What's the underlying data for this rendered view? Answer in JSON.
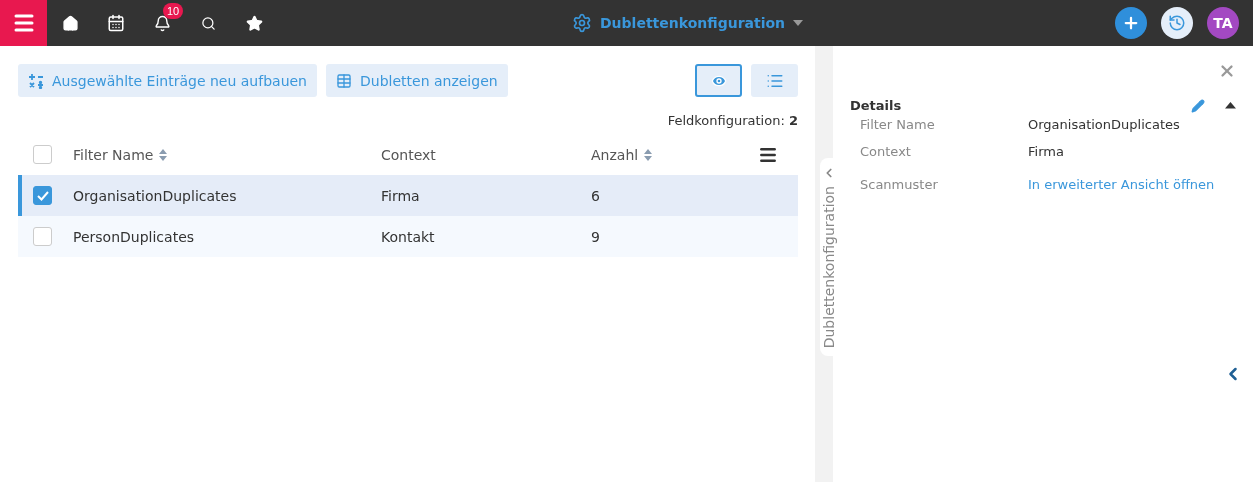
{
  "topbar": {
    "notification_count": "10",
    "title": "Dublettenkonfiguration",
    "avatar_initials": "TA"
  },
  "toolbar": {
    "buttons": [
      {
        "kind": "rebuild",
        "label": "Ausgewählte Einträge neu aufbauen"
      },
      {
        "kind": "table",
        "label": "Dubletten anzeigen"
      }
    ],
    "views": [
      {
        "kind": "eye",
        "selected": true
      },
      {
        "kind": "list",
        "selected": false
      }
    ]
  },
  "count": {
    "label": "Feldkonfiguration:",
    "value": "2"
  },
  "table": {
    "columns": [
      {
        "label": "Filter Name",
        "sortable": true
      },
      {
        "label": "Context",
        "sortable": false
      },
      {
        "label": "Anzahl",
        "sortable": true
      }
    ],
    "all_checked": false,
    "rows": [
      {
        "cells": [
          "OrganisationDuplicates",
          "Firma",
          "6"
        ],
        "selected": true
      },
      {
        "cells": [
          "PersonDuplicates",
          "Kontakt",
          "9"
        ],
        "selected": false
      }
    ]
  },
  "side_tab": {
    "label": "Dublettenkonfiguration"
  },
  "details": {
    "title": "Details",
    "expanded": true,
    "fields": [
      {
        "label": "Filter Name",
        "value": "OrganisationDuplicates",
        "kind": "text"
      },
      {
        "label": "Context",
        "value": "Firma",
        "kind": "text"
      },
      {
        "label": "Scanmuster",
        "value": "In erweiterter Ansicht öffnen",
        "kind": "link"
      }
    ]
  }
}
